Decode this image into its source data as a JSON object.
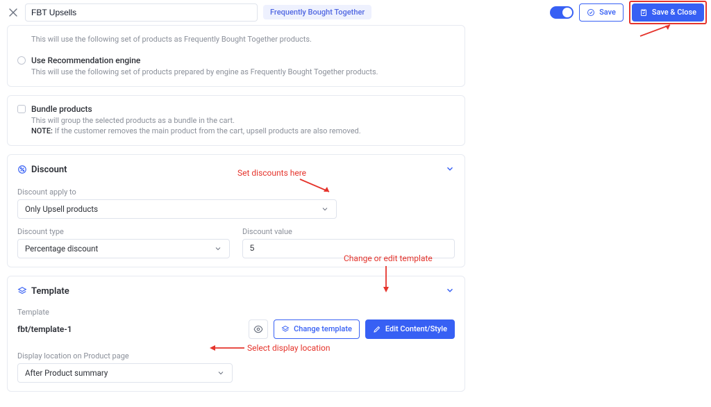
{
  "header": {
    "title_value": "FBT Upsells",
    "tag": "Frequently Bought Together",
    "save_label": "Save",
    "save_close_label": "Save & Close"
  },
  "options": {
    "opt1_desc": "This will use the following set of products as Frequently Bought Together products.",
    "opt2_title": "Use Recommendation engine",
    "opt2_desc": "This will use the following set of products prepared by engine as Frequently Bought Together products.",
    "bundle_title": "Bundle products",
    "bundle_desc": "This will group the selected products as a bundle in the cart.",
    "bundle_note_label": "NOTE: ",
    "bundle_note": "If the customer removes the main product from the cart, upsell products are also removed."
  },
  "discount": {
    "section_title": "Discount",
    "apply_label": "Discount apply to",
    "apply_value": "Only Upsell products",
    "type_label": "Discount type",
    "type_value": "Percentage discount",
    "value_label": "Discount value",
    "value_value": "5"
  },
  "template": {
    "section_title": "Template",
    "name_label": "Template",
    "name_value": "fbt/template-1",
    "change_label": "Change template",
    "edit_label": "Edit Content/Style",
    "location_label": "Display location on Product page",
    "location_value": "After Product summary"
  },
  "anno": {
    "discount_note": "Set discounts here",
    "template_note": "Change or edit template",
    "location_note": "Select display location"
  }
}
